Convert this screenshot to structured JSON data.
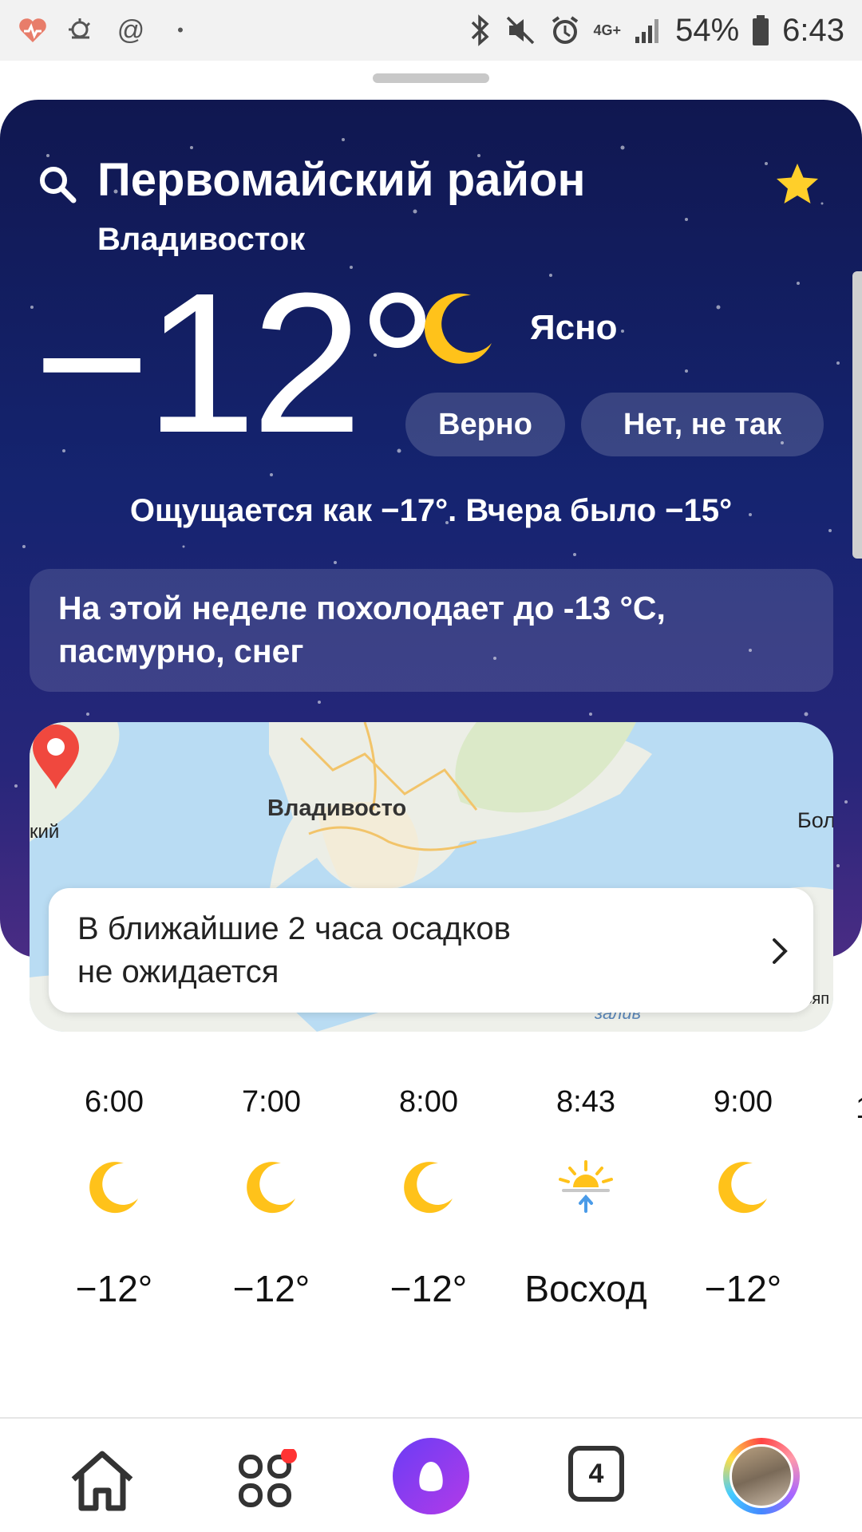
{
  "status_bar": {
    "network": "4G+",
    "battery": "54%",
    "time": "6:43"
  },
  "header": {
    "title": "Первомайский район",
    "city": "Владивосток"
  },
  "current": {
    "temperature": "−12°",
    "condition": "Ясно",
    "feels_like": "Ощущается как −17°. Вчера было −15°"
  },
  "feedback": {
    "yes_label": "Верно",
    "no_label": "Нет, не так"
  },
  "week_notice": {
    "line1": "На этой неделе похолодает до -13 °C,",
    "line2": "пасмурно, снег"
  },
  "map": {
    "city_label": "Владивосто",
    "left_label": "кий",
    "right_label": "Бол",
    "gulf_label": "залив",
    "right_label2": "ьяп"
  },
  "precipitation": {
    "line1": "В ближайшие 2 часа осадков",
    "line2": "не ожидается"
  },
  "hourly": [
    {
      "time": "6:00",
      "icon": "moon-icon",
      "value": "−12°"
    },
    {
      "time": "7:00",
      "icon": "moon-icon",
      "value": "−12°"
    },
    {
      "time": "8:00",
      "icon": "moon-icon",
      "value": "−12°"
    },
    {
      "time": "8:43",
      "icon": "sunrise-icon",
      "value": "Восход"
    },
    {
      "time": "9:00",
      "icon": "moon-icon",
      "value": "−12°"
    }
  ],
  "hourly_cut": "1",
  "nav": {
    "tabs_count": "4"
  },
  "colors": {
    "hero_top": "#101750",
    "hero_bottom": "#4a2c84",
    "accent_yellow": "#ffc21a",
    "pin_red": "#f0483e",
    "alice_purple": "#8a3cf0"
  }
}
